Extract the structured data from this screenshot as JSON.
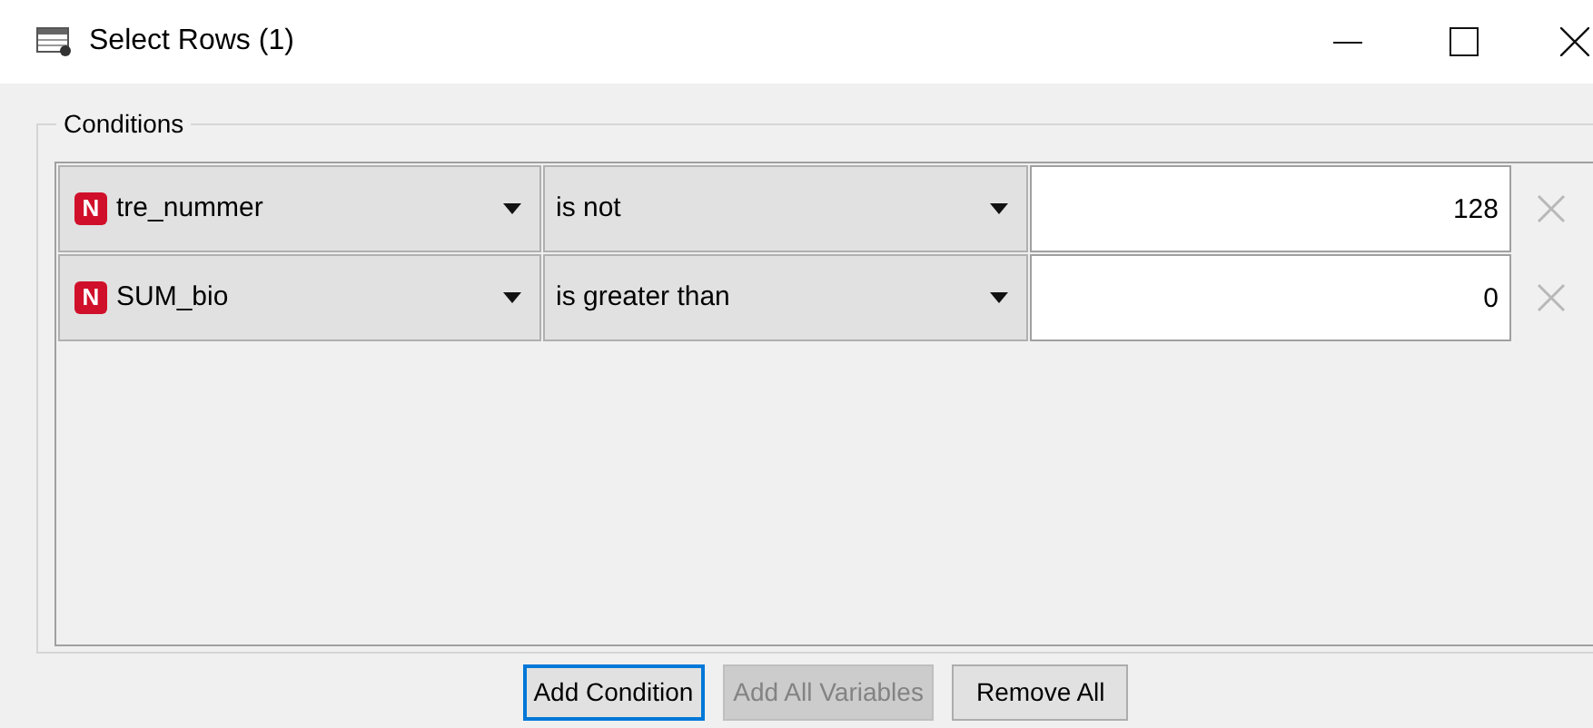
{
  "window": {
    "title": "Select Rows (1)"
  },
  "conditions": {
    "title": "Conditions",
    "rows": [
      {
        "type_badge": "N",
        "variable": "tre_nummer",
        "operator": "is not",
        "value": "128"
      },
      {
        "type_badge": "N",
        "variable": "SUM_bio",
        "operator": "is greater than",
        "value": "0"
      }
    ]
  },
  "buttons": [
    {
      "label": "Add Condition",
      "focused": true,
      "disabled": false
    },
    {
      "label": "Add All Variables",
      "focused": false,
      "disabled": true
    },
    {
      "label": "Remove All",
      "focused": false,
      "disabled": false
    }
  ]
}
